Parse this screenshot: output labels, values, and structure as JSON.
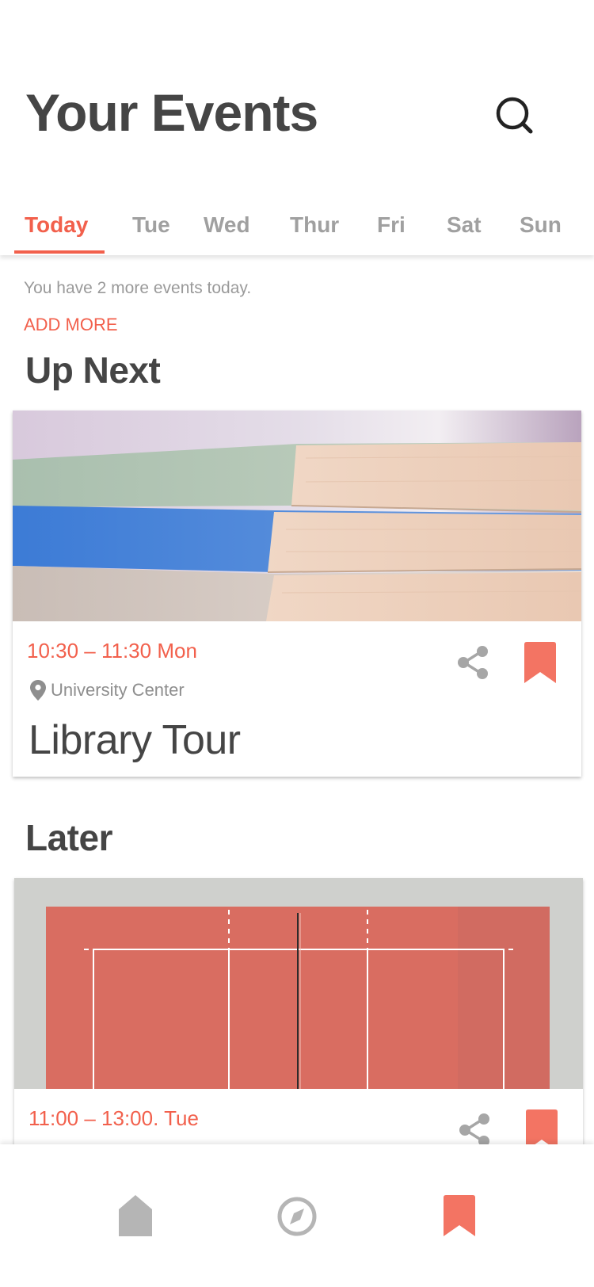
{
  "header": {
    "title": "Your Events",
    "search_icon": "search-icon"
  },
  "tabs": [
    {
      "label": "Today",
      "active": true
    },
    {
      "label": "Tue",
      "active": false
    },
    {
      "label": "Wed",
      "active": false
    },
    {
      "label": "Thur",
      "active": false
    },
    {
      "label": "Fri",
      "active": false
    },
    {
      "label": "Sat",
      "active": false
    },
    {
      "label": "Sun",
      "active": false
    }
  ],
  "summary": {
    "text": "You have 2 more events today.",
    "add_more_label": "ADD MORE"
  },
  "sections": {
    "up_next_title": "Up Next",
    "later_title": "Later"
  },
  "events": [
    {
      "time": "10:30 – 11:30  Mon",
      "location": "University Center",
      "title": "Library Tour",
      "image": "stacked-books-photo",
      "share_icon": "share-icon",
      "bookmark_icon": "bookmark-icon"
    },
    {
      "time": "11:00 – 13:00. Tue",
      "image": "volleyball-court-photo",
      "share_icon": "share-icon",
      "bookmark_icon": "bookmark-icon"
    }
  ],
  "bottom_nav": [
    {
      "icon": "home-icon",
      "active": false
    },
    {
      "icon": "compass-icon",
      "active": false
    },
    {
      "icon": "bookmark-icon",
      "active": true
    }
  ],
  "colors": {
    "accent": "#f2604c",
    "text": "#454545",
    "muted": "#a0a0a0",
    "bookmark": "#f37463"
  }
}
